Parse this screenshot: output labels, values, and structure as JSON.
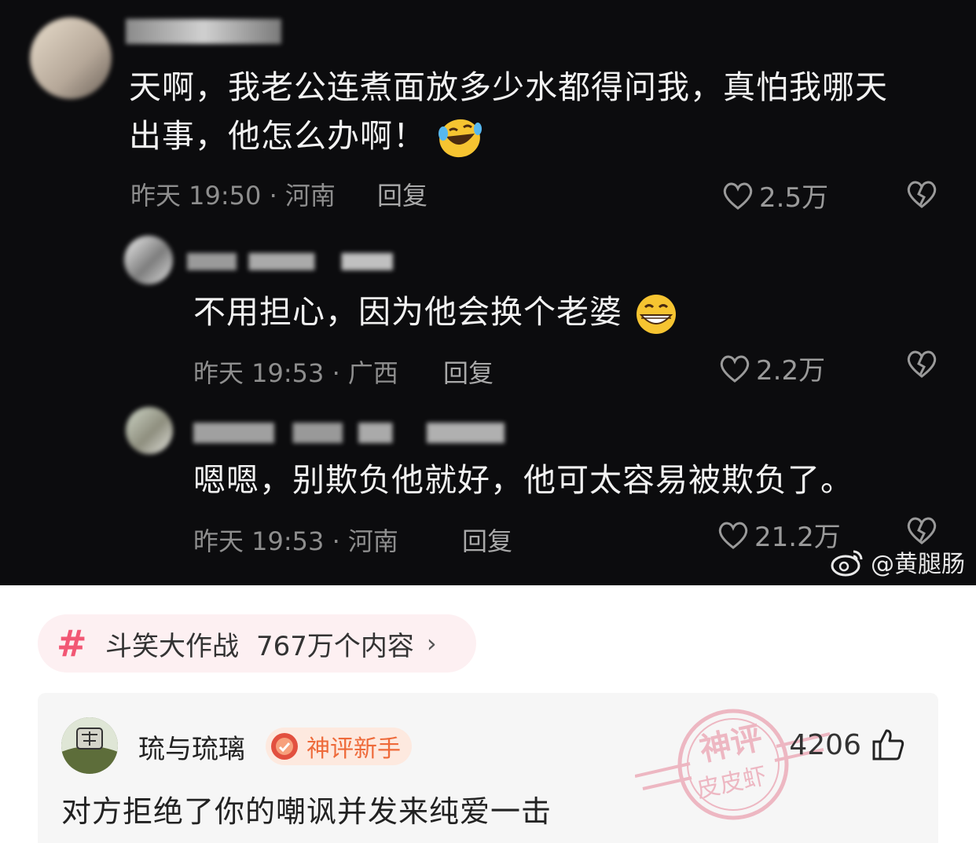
{
  "screenshot": {
    "comments": [
      {
        "text_line1": "天啊，我老公连煮面放多少水都得问我，真怕我哪天",
        "text_line2": "出事，他怎么办啊！",
        "time_location": "昨天 19:50 · 河南",
        "reply_label": "回复",
        "likes": "2.5万",
        "emoji": "laughing-tears-icon"
      },
      {
        "text": "不用担心，因为他会换个老婆",
        "time_location": "昨天 19:53 · 广西",
        "reply_label": "回复",
        "likes": "2.2万",
        "emoji": "grinning-icon"
      },
      {
        "text": "嗯嗯，别欺负他就好，他可太容易被欺负了。",
        "time_location": "昨天 19:53 · 河南",
        "reply_label": "回复",
        "likes": "21.2万"
      }
    ],
    "watermark": "@黄腿肠"
  },
  "topic": {
    "name": "斗笑大作战",
    "count": "767万个内容",
    "chevron": "›"
  },
  "god_comment": {
    "username": "琉与琉璃",
    "badge": "神评新手",
    "like_count": "4206",
    "text": "对方拒绝了你的嘲讽并发来纯爱一击",
    "stamp_line1": "神评",
    "stamp_line2": "皮皮虾"
  },
  "colors": {
    "accent_pink": "#f25774",
    "badge_orange": "#ee6a3a",
    "dark_bg": "#0c0c0e"
  }
}
